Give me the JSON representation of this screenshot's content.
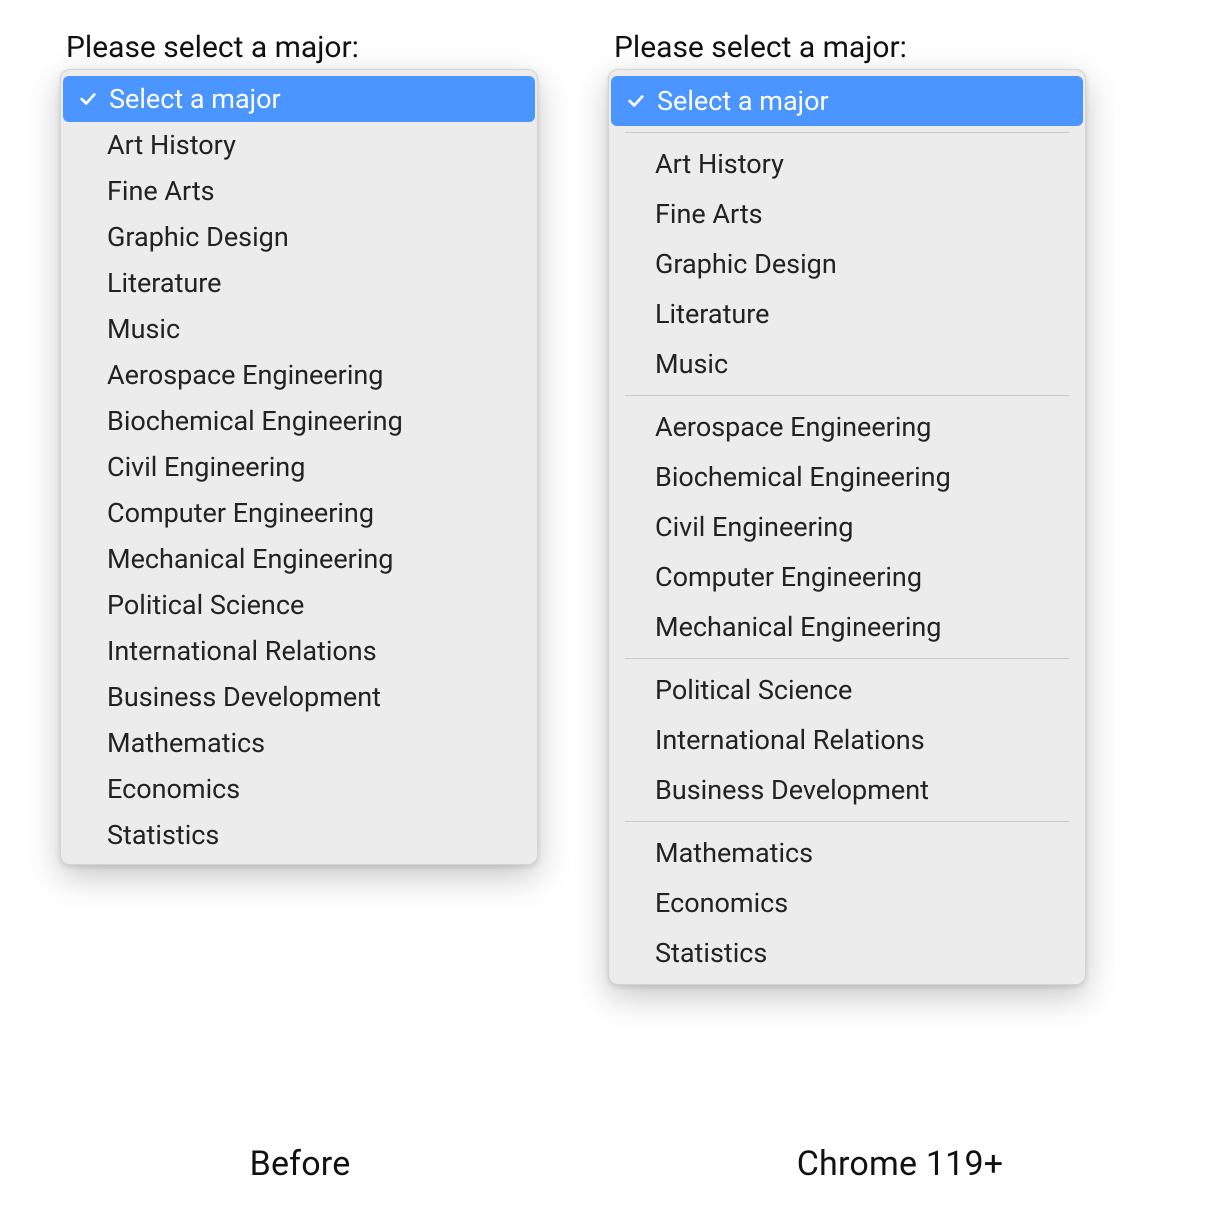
{
  "prompt": "Please select a major:",
  "selected_label": "Select a major",
  "flat_options": [
    "Art History",
    "Fine Arts",
    "Graphic Design",
    "Literature",
    "Music",
    "Aerospace Engineering",
    "Biochemical Engineering",
    "Civil Engineering",
    "Computer Engineering",
    "Mechanical Engineering",
    "Political Science",
    "International Relations",
    "Business Development",
    "Mathematics",
    "Economics",
    "Statistics"
  ],
  "groups": [
    [
      "Art History",
      "Fine Arts",
      "Graphic Design",
      "Literature",
      "Music"
    ],
    [
      "Aerospace Engineering",
      "Biochemical Engineering",
      "Civil Engineering",
      "Computer Engineering",
      "Mechanical Engineering"
    ],
    [
      "Political Science",
      "International Relations",
      "Business Development"
    ],
    [
      "Mathematics",
      "Economics",
      "Statistics"
    ]
  ],
  "captions": {
    "left": "Before",
    "right": "Chrome 119+"
  },
  "colors": {
    "highlight": "#4a95ff",
    "menu_bg": "#ececec",
    "text": "#222222"
  }
}
